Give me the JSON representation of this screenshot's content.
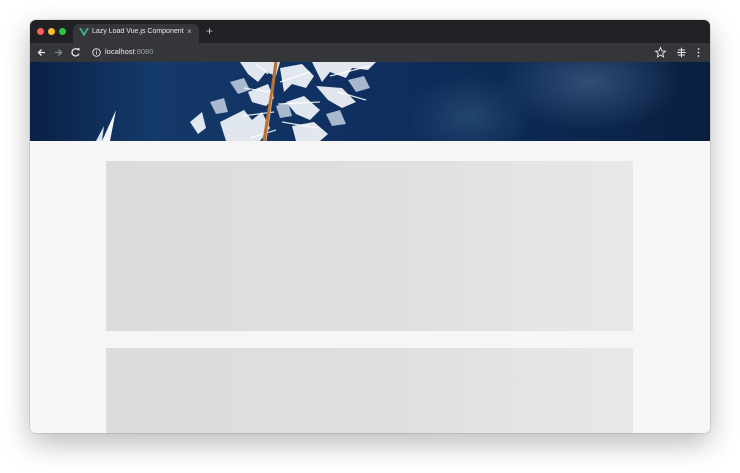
{
  "browser": {
    "tab": {
      "title": "Lazy Load Vue.js Components",
      "favicon": "vue-logo-icon",
      "close": "×"
    },
    "new_tab": "+",
    "address_bar": {
      "host": "localhost",
      "port": ":8080",
      "info_icon": "info-icon"
    },
    "toolbar_icons": [
      "back-icon",
      "forward-icon",
      "reload-icon",
      "star-icon",
      "extension-icon",
      "menu-icon"
    ]
  },
  "page": {
    "hero_image": "frost-plant-on-blue-background",
    "placeholders": [
      "loading-placeholder",
      "loading-placeholder"
    ]
  },
  "colors": {
    "tabbar": "#202124",
    "toolbar": "#35363a",
    "page_bg": "#f6f6f7",
    "placeholder": "#dddcdd",
    "vue_green": "#42b883"
  }
}
